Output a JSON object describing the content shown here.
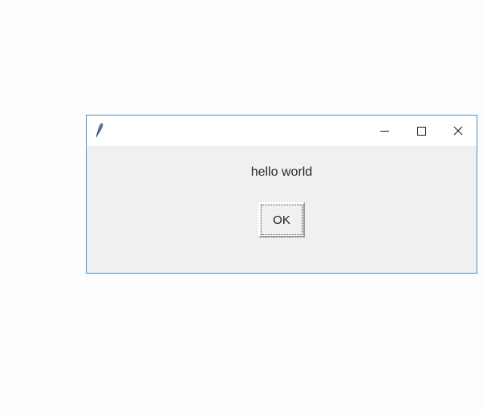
{
  "window": {
    "title": "",
    "message": "hello world",
    "ok_label": "OK"
  }
}
